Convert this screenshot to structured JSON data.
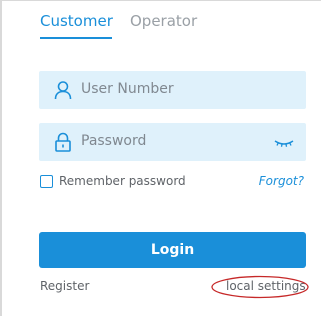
{
  "tabs": [
    {
      "label": "Customer",
      "active": true
    },
    {
      "label": "Operator",
      "active": false
    }
  ],
  "form": {
    "user_placeholder": "User Number",
    "password_placeholder": "Password",
    "remember_label": "Remember password",
    "remember_checked": false,
    "forgot_label": "Forgot?"
  },
  "actions": {
    "login_label": "Login",
    "register_label": "Register",
    "local_settings_label": "local settings"
  },
  "icons": {
    "user": "user-icon",
    "lock": "lock-icon",
    "eye": "eye-closed-icon"
  },
  "colors": {
    "accent": "#1a8fd9",
    "field_background": "#dff1fb",
    "highlight_annotation": "#c62828"
  }
}
